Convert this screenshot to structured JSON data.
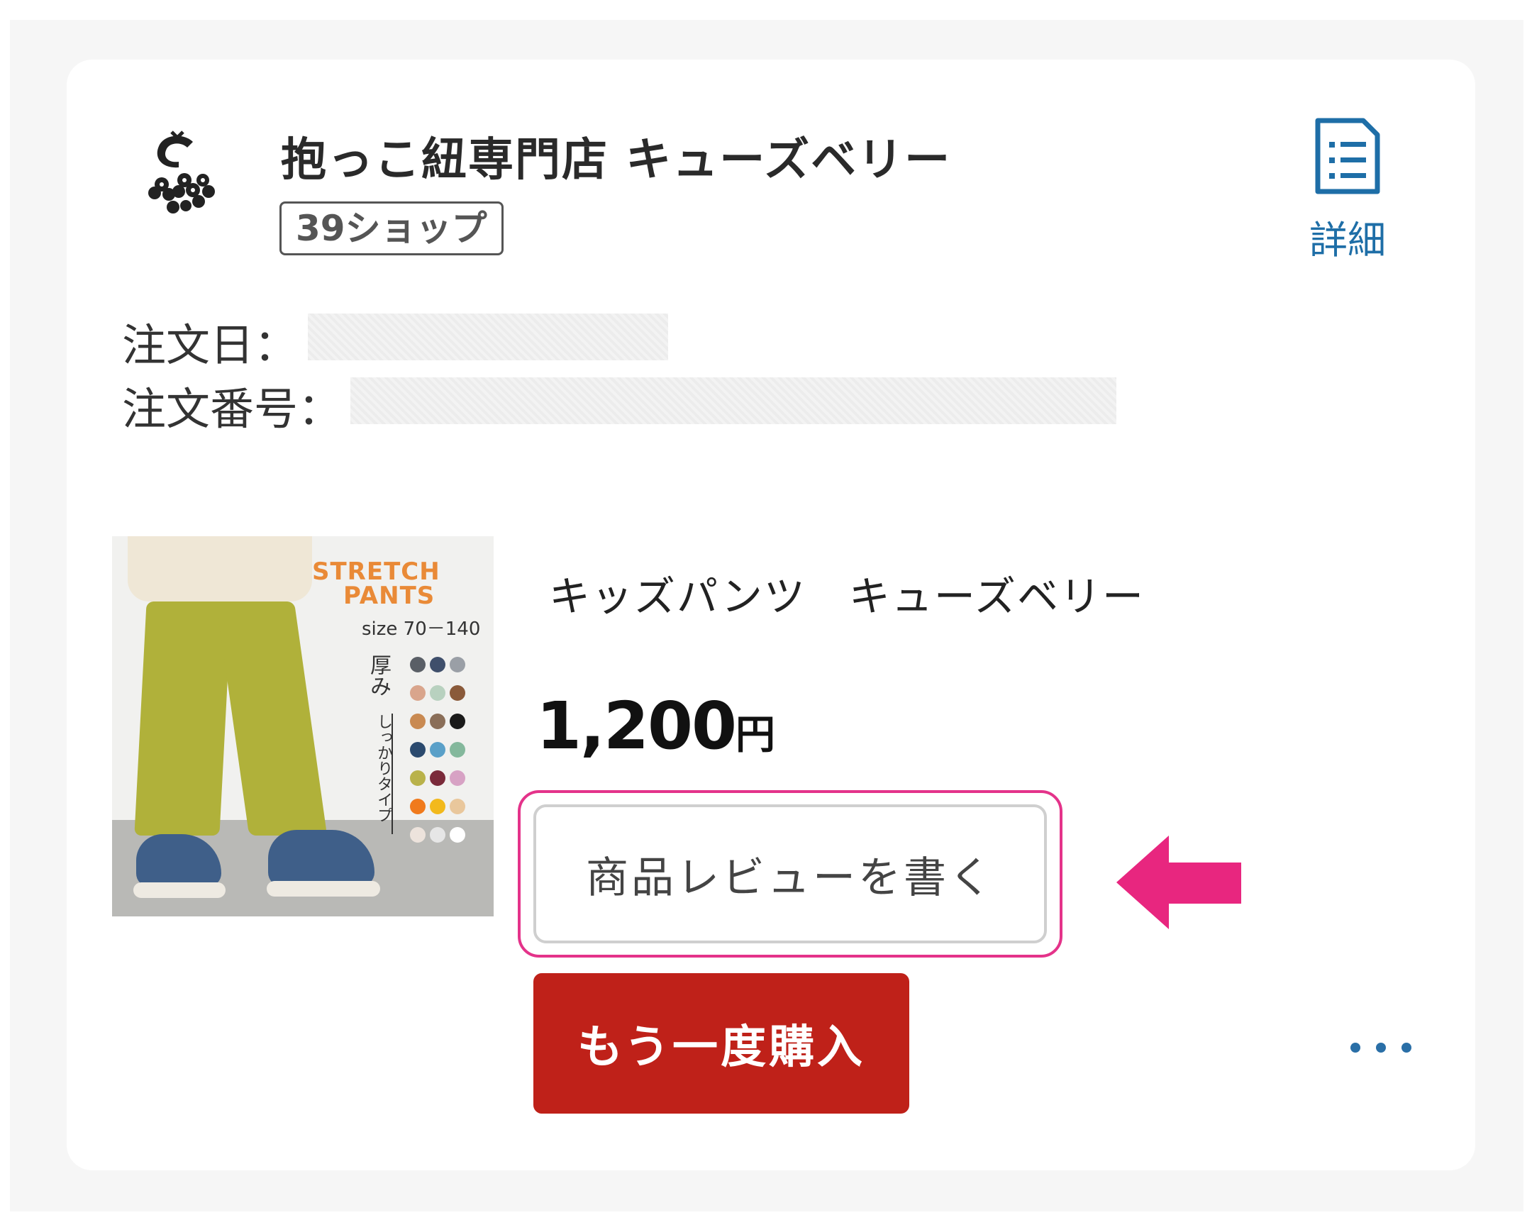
{
  "shop": {
    "name": "抱っこ紐専門店 キューズベリー",
    "badge": "39ショップ",
    "logo_icon": "cuseberry-logo",
    "detail_label": "詳細",
    "detail_icon": "document-list-icon"
  },
  "order": {
    "date_label": "注文日：",
    "date_value": "",
    "number_label": "注文番号：",
    "number_value": ""
  },
  "product": {
    "title": "キッズパンツ　キューズベリー",
    "price_number": "1,200",
    "price_unit": "円",
    "image": {
      "brand_line1": "STRETCH",
      "brand_line2": "PANTS",
      "size_text": "size 70－140",
      "thick_text": "厚み",
      "sub_text": "しっかりタイプ",
      "swatch_colors": [
        "#5a5f66",
        "#3f4f6b",
        "#9a9fa6",
        "#d9a58c",
        "#b8d1bf",
        "#8a5a3a",
        "#c98a52",
        "#8a6e58",
        "#1a1a1a",
        "#2b4a6e",
        "#5aa0c8",
        "#84b89c",
        "#b9b24a",
        "#7a2a3a",
        "#d7a2c4",
        "#f07a1c",
        "#f2b91c",
        "#e9c79c",
        "#ede3dc",
        "#e6e6e6",
        "#ffffff"
      ]
    }
  },
  "actions": {
    "review_label": "商品レビューを書く",
    "rebuy_label": "もう一度購入",
    "more_icon": "more-dots-icon"
  },
  "colors": {
    "accent_blue": "#1e6ea7",
    "rebuy_red": "#bf2119",
    "highlight_pink": "#e4338a"
  }
}
